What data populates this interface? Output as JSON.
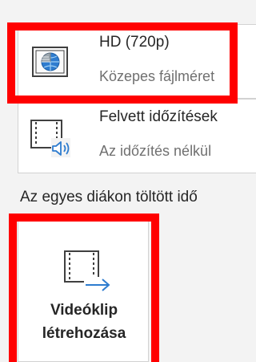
{
  "export_options": {
    "quality_item": {
      "title": "HD (720p)",
      "description": "Közepes fájlméret",
      "icon": "hd-monitor-icon"
    },
    "timings_item": {
      "title": "Felvett időzítések",
      "description": "Az időzítés nélkül",
      "icon": "timings-narration-icon"
    },
    "per_slide_label": "Az egyes diákon töltött idő",
    "create_video": {
      "line1": "Videóklip",
      "line2": "létrehozása",
      "icon": "video-export-icon"
    }
  },
  "highlight_color": "#ff0000"
}
